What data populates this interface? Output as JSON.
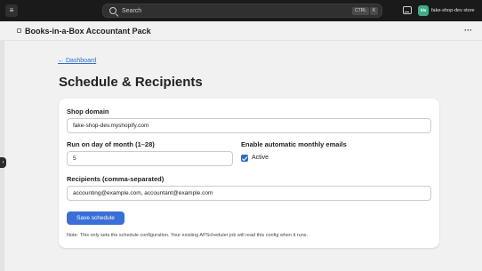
{
  "topbar": {
    "logo_text": "≡",
    "search_placeholder": "Search",
    "shortcut_ctrl": "CTRL",
    "shortcut_key": "K",
    "avatar_initials": "fds",
    "store_name": "fake-shop-dev store"
  },
  "app_header": {
    "title": "Books-in-a-Box Accountant Pack",
    "more_label": "···"
  },
  "page": {
    "back_link": "← Dashboard",
    "title": "Schedule & Recipients"
  },
  "form": {
    "shop_domain_label": "Shop domain",
    "shop_domain_value": "fake-shop-dev.myshopify.com",
    "run_day_label": "Run on day of month (1–28)",
    "run_day_value": "5",
    "enable_label": "Enable automatic monthly emails",
    "active_label": "Active",
    "active_checked": true,
    "recipients_label": "Recipients (comma-separated)",
    "recipients_value": "accounting@example.com, accountant@example.com",
    "save_button": "Save schedule",
    "note": "Note: This only sets the schedule configuration. Your existing APScheduler job will read this config when it runs."
  },
  "colors": {
    "topbar_bg": "#1a1a1a",
    "page_bg": "#f1f1f1",
    "primary": "#3a6fd8",
    "link": "#2c6ecb"
  }
}
